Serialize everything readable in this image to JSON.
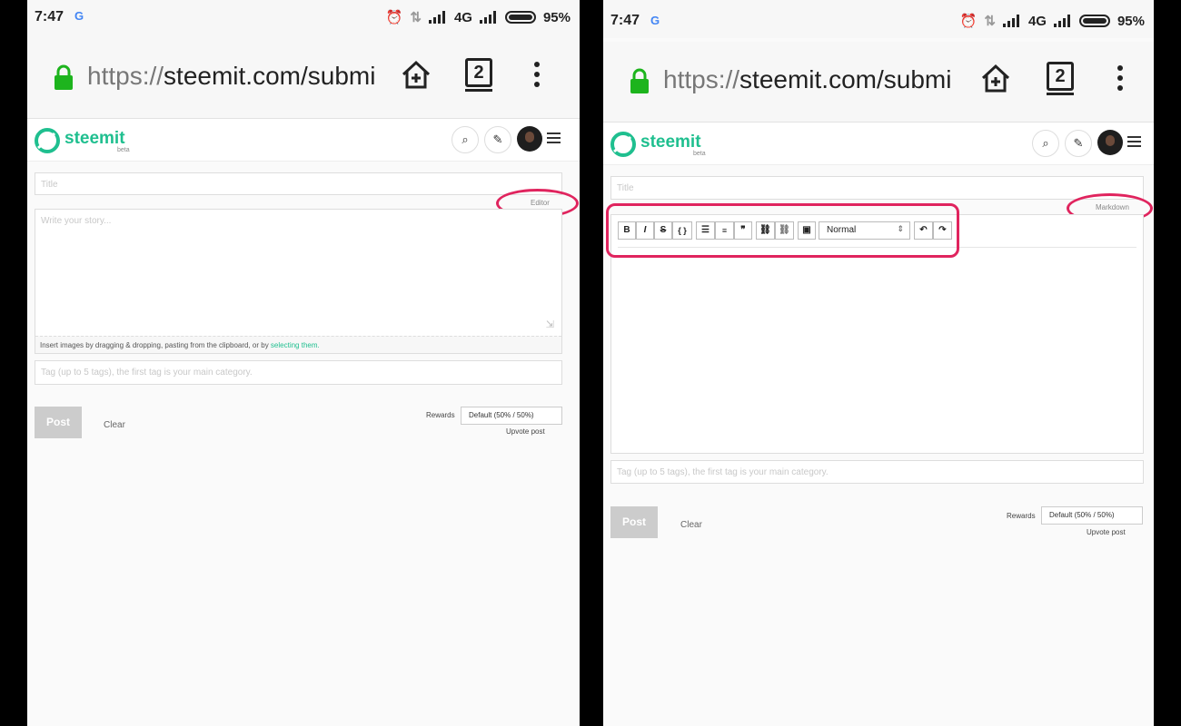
{
  "status": {
    "time": "7:47",
    "google": "G",
    "network": "4G",
    "battery": "95%"
  },
  "browser": {
    "url_scheme": "https://",
    "url_host": "steemit.com/submi",
    "tab_count": "2"
  },
  "site": {
    "logo_text": "steemit",
    "logo_sub": "beta"
  },
  "left": {
    "title_placeholder": "Title",
    "mode_toggle": "Editor",
    "body_placeholder": "Write your story...",
    "insert_hint": "Insert images by dragging & dropping, pasting from the clipboard, or by ",
    "insert_link": "selecting them.",
    "tag_placeholder": "Tag (up to 5 tags), the first tag is your main category.",
    "post_label": "Post",
    "clear_label": "Clear",
    "rewards_label": "Rewards",
    "rewards_value": "Default (50% / 50%)",
    "upvote_label": "Upvote post"
  },
  "right": {
    "title_placeholder": "Title",
    "mode_toggle": "Markdown",
    "toolbar": {
      "bold": "B",
      "italic": "I",
      "strike": "S",
      "code": "{ }",
      "format_value": "Normal"
    },
    "tag_placeholder": "Tag (up to 5 tags), the first tag is your main category.",
    "post_label": "Post",
    "clear_label": "Clear",
    "rewards_label": "Rewards",
    "rewards_value": "Default (50% / 50%)",
    "upvote_label": "Upvote post"
  },
  "colors": {
    "brand": "#1fbf8f",
    "annotation": "#e0245e",
    "lock": "#1db41d"
  },
  "icons": [
    "google-icon",
    "alarm-icon",
    "data-arrows-icon",
    "signal-icon",
    "battery-icon",
    "lock-icon",
    "home-add-icon",
    "tabs-icon",
    "overflow-menu-icon",
    "search-icon",
    "pencil-icon",
    "avatar",
    "hamburger-icon",
    "resize-icon",
    "bullet-list-icon",
    "numbered-list-icon",
    "quote-icon",
    "link-icon",
    "unlink-icon",
    "image-icon",
    "undo-icon",
    "redo-icon"
  ]
}
